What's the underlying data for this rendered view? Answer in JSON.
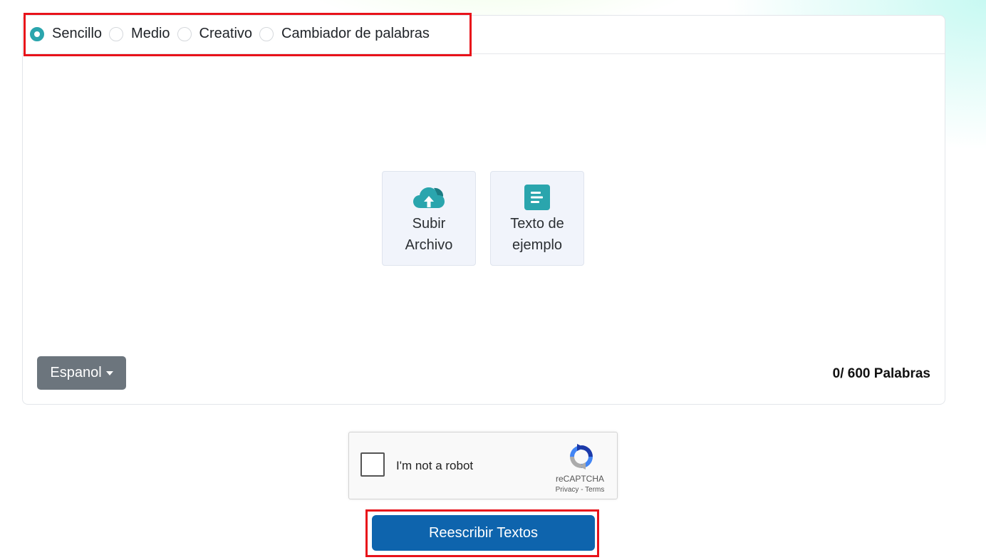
{
  "modes": [
    {
      "label": "Sencillo",
      "checked": true
    },
    {
      "label": "Medio",
      "checked": false
    },
    {
      "label": "Creativo",
      "checked": false
    },
    {
      "label": "Cambiador de palabras",
      "checked": false
    }
  ],
  "tiles": {
    "upload": {
      "label": "Subir Archivo",
      "icon": "cloud-upload-icon"
    },
    "sample": {
      "label": "Texto de ejemplo",
      "icon": "document-text-icon"
    }
  },
  "language": {
    "selected": "Espanol"
  },
  "word_count": "0/ 600 Palabras",
  "recaptcha": {
    "label": "I'm not a robot",
    "brand": "reCAPTCHA",
    "privacy": "Privacy",
    "separator": "-",
    "terms": "Terms"
  },
  "submit": {
    "label": "Reescribir Textos"
  },
  "colors": {
    "accent": "#2aa5ad",
    "primary_button": "#0e64ad",
    "language_button": "#6c757d",
    "highlight": "#e8121a"
  }
}
